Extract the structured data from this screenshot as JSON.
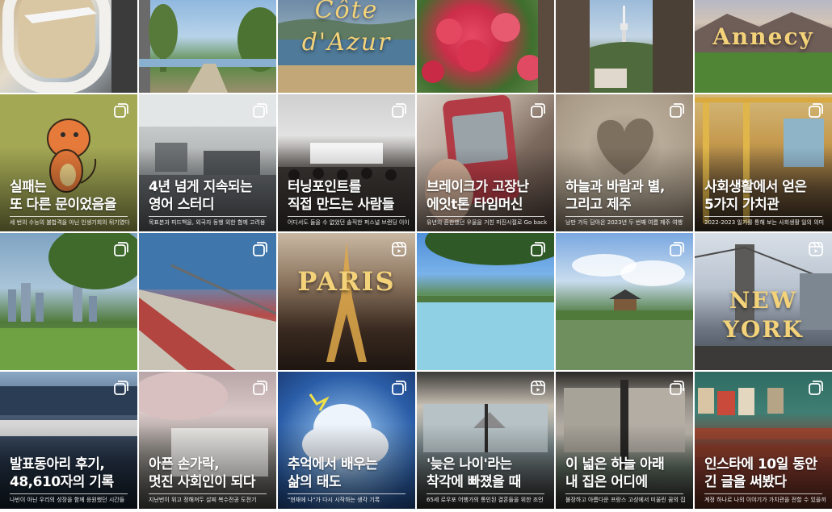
{
  "colors": {
    "overlay_text": "#ffffff",
    "serif_title": "#f3d27a",
    "gradient_dark": "#000000"
  },
  "tiles": [
    {
      "name": "airplane-window-post",
      "title": "",
      "caption": "",
      "badge": "none"
    },
    {
      "name": "riverside-bike-post",
      "title": "",
      "caption": "",
      "badge": "none"
    },
    {
      "name": "cote-dazur-post",
      "title": "",
      "caption": "",
      "badge": "none",
      "overlay": "Côte\nd'Azur"
    },
    {
      "name": "red-flowers-post",
      "title": "",
      "caption": "",
      "badge": "none"
    },
    {
      "name": "seoul-tower-post",
      "title": "",
      "caption": "",
      "badge": "none"
    },
    {
      "name": "annecy-post",
      "title": "",
      "caption": "",
      "badge": "none",
      "overlay": "Annecy"
    },
    {
      "name": "failure-post",
      "title": "실패는\n또 다른 문이었음을",
      "caption": "세 번의 수능의 불합격을 아닌 인생기회의 뒤기였다",
      "badge": "carousel"
    },
    {
      "name": "english-study-post",
      "title": "4년 넘게 지속되는\n영어 스터디",
      "caption": "목표본과 피드백을, 외국자 동행 외한 함께 고려용",
      "badge": "carousel"
    },
    {
      "name": "turning-point-post",
      "title": "터닝포인트를\n직접 만드는 사람들",
      "caption": "어디서도 들을 수 없었던 솔직한 퍼스널 브랜딩 이야기",
      "badge": "carousel"
    },
    {
      "name": "broken-phone-post",
      "title": "브레이크가 고장난\n에잇t톤 타임머신",
      "caption": "유년의 흔한했던 우울을 거친 피진시절로 Go back",
      "badge": "carousel"
    },
    {
      "name": "sky-wind-stars-post",
      "title": "하늘과 바람과 별,\n그리고 제주",
      "caption": "낭만 가득 담아온 2023년 두 번째 여름 제주 여행",
      "badge": "carousel"
    },
    {
      "name": "social-life-values-post",
      "title": "사회생활에서 얻은\n5가지 가치관",
      "caption": "2022-2023 일기를 통해 보는 사회생활 일의 의미",
      "badge": "carousel"
    },
    {
      "name": "city-park-post",
      "title": "",
      "caption": "",
      "badge": "carousel"
    },
    {
      "name": "bike-path-post",
      "title": "",
      "caption": "",
      "badge": "carousel"
    },
    {
      "name": "paris-post",
      "title": "",
      "caption": "",
      "badge": "reel",
      "overlay": "PARIS"
    },
    {
      "name": "lake-post",
      "title": "",
      "caption": "",
      "badge": "carousel"
    },
    {
      "name": "pavilion-post",
      "title": "",
      "caption": "",
      "badge": "carousel"
    },
    {
      "name": "new-york-post",
      "title": "",
      "caption": "",
      "badge": "reel",
      "overlay": "NEW\nYORK"
    },
    {
      "name": "presentation-club-post",
      "title": "발표동아리 후기,\n48,610자의 기록",
      "caption": "나빈이 아닌 우리의 성장을 함께 응원했던 시간들",
      "badge": "carousel"
    },
    {
      "name": "sore-fingers-post",
      "title": "아픈 손가락,\n멋진 사회인이 되다",
      "caption": "지난번이 위고 정해져두 살찌 복수전공 도전기",
      "badge": "carousel"
    },
    {
      "name": "memories-attitude-post",
      "title": "추억에서 배우는\n삶의 태도",
      "caption": "\"현재에 나\"가 다시 시작하는 생각 기록",
      "badge": "carousel"
    },
    {
      "name": "late-age-post",
      "title": "'늦은 나이'라는\n착각에 빠졌을 때",
      "caption": "65세 로우포 어행가의 통인된 결혼들을 위한 조언",
      "badge": "reel"
    },
    {
      "name": "wide-sky-home-post",
      "title": "이 넓은 하늘 아래\n내 집은 어디에",
      "caption": "불장하고 아름다운 프랑스 고성에서 미울린 꿈의 집",
      "badge": "carousel"
    },
    {
      "name": "instagram-10-days-post",
      "title": "인스타에 10일 동안\n긴 글을 써봤다",
      "caption": "계정 하나로 나의 이야기가 가치관을 전할 수 있을까",
      "badge": "carousel"
    }
  ]
}
